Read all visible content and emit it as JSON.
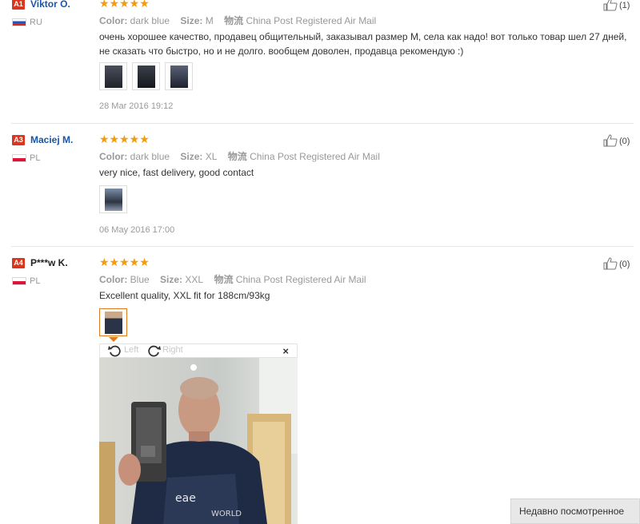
{
  "reviews": [
    {
      "badge": "A1",
      "name": "Viktor O.",
      "country": "RU",
      "stars": "★★★★★",
      "color_label": "Color:",
      "color_value": "dark blue",
      "size_label": "Size:",
      "size_value": "M",
      "shipping_label": "物流",
      "shipping_value": "China Post Registered Air Mail",
      "text": "очень хорошее качество, продавец общительный, заказывал размер М, села как надо! вот только товар шел 27 дней, не сказать что быстро, но и не долго. вообщем доволен, продавца рекомендую :)",
      "date": "28 Mar 2016 19:12",
      "likes": "(1)"
    },
    {
      "badge": "A3",
      "name": "Maciej M.",
      "country": "PL",
      "stars": "★★★★★",
      "color_label": "Color:",
      "color_value": "dark blue",
      "size_label": "Size:",
      "size_value": "XL",
      "shipping_label": "物流",
      "shipping_value": "China Post Registered Air Mail",
      "text": "very nice, fast delivery, good contact",
      "date": "06 May 2016 17:00",
      "likes": "(0)"
    },
    {
      "badge": "A4",
      "name": "P***w K.",
      "country": "PL",
      "stars": "★★★★★",
      "color_label": "Color:",
      "color_value": "Blue",
      "size_label": "Size:",
      "size_value": "XXL",
      "shipping_label": "物流",
      "shipping_value": "China Post Registered Air Mail",
      "text": "Excellent quality, XXL fit for 188cm/93kg",
      "likes": "(0)"
    }
  ],
  "viewer": {
    "rotate_left": "Left",
    "rotate_right": "Right",
    "close": "×"
  },
  "recently_viewed": "Недавно посмотренное"
}
